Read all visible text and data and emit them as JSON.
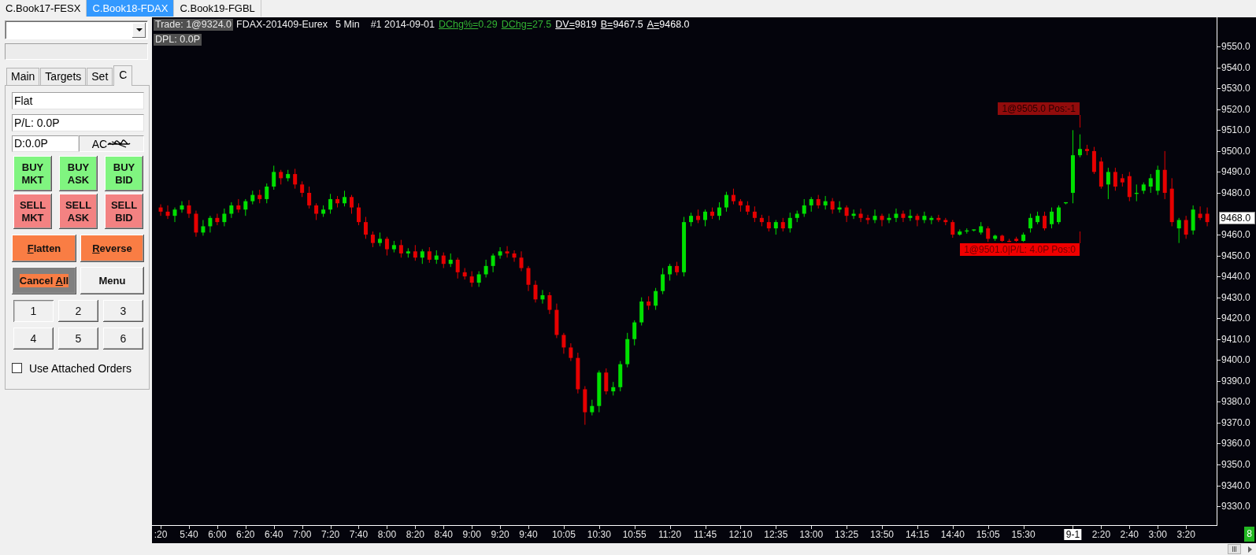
{
  "tabs": [
    {
      "label": "C.Book17-FESX",
      "selected": false
    },
    {
      "label": "C.Book18-FDAX",
      "selected": true
    },
    {
      "label": "C.Book19-FGBL",
      "selected": false
    }
  ],
  "panel": {
    "tabs": [
      {
        "label": "Main",
        "selected": false
      },
      {
        "label": "Targets",
        "selected": false
      },
      {
        "label": "Set",
        "selected": false
      },
      {
        "label": "C",
        "selected": true
      }
    ],
    "position": "Flat",
    "pl": "P/L: 0.0P",
    "daily": "D:0.0P",
    "account": "AC",
    "order_buttons": [
      {
        "kind": "buy",
        "lines": [
          "BUY",
          "MKT"
        ]
      },
      {
        "kind": "buy",
        "lines": [
          "BUY",
          "ASK"
        ]
      },
      {
        "kind": "buy",
        "lines": [
          "BUY",
          "BID"
        ]
      },
      {
        "kind": "sell",
        "lines": [
          "SELL",
          "MKT"
        ]
      },
      {
        "kind": "sell",
        "lines": [
          "SELL",
          "ASK"
        ]
      },
      {
        "kind": "sell",
        "lines": [
          "SELL",
          "BID"
        ]
      }
    ],
    "action_buttons": [
      {
        "kind": "accent",
        "mnemonic": "F",
        "label_end": "latten"
      },
      {
        "kind": "accent",
        "mnemonic": "R",
        "label_end": "everse"
      },
      {
        "kind": "shaded",
        "label_start": "Cancel ",
        "mnemonic": "A",
        "label_end": "ll"
      },
      {
        "kind": "plain",
        "label_start": "Menu"
      }
    ],
    "quantity_buttons": [
      {
        "label": "1",
        "selected": true
      },
      {
        "label": "2",
        "selected": false
      },
      {
        "label": "3",
        "selected": false
      },
      {
        "label": "4",
        "selected": false
      },
      {
        "label": "5",
        "selected": false
      },
      {
        "label": "6",
        "selected": false
      }
    ],
    "attached_orders": {
      "label": "Use Attached Orders",
      "checked": false
    }
  },
  "chart": {
    "header": {
      "trade": "Trade: 1@9324.0",
      "instrument": "FDAX-201409-Eurex",
      "interval": "5 Min",
      "bar_info": "#1 2014-09-01",
      "stats": [
        {
          "label": "DChg%=",
          "value": "0.29",
          "color": "#33b533"
        },
        {
          "label": "DChg=",
          "value": "27.5",
          "color": "#33b533"
        },
        {
          "label": "DV=",
          "value": "9819",
          "color": "#ffffff"
        },
        {
          "label": "B=",
          "value": "9467.5",
          "color": "#ffffff"
        },
        {
          "label": "A=",
          "value": "9468.0",
          "color": "#ffffff"
        }
      ],
      "dpl": "DPL: 0.0P"
    },
    "orders": [
      {
        "kind": "working",
        "text": "1@9505.0 Pos:-1"
      },
      {
        "kind": "filled",
        "text": "1@9501.0|P/L: 4.0P Pos:0"
      }
    ],
    "chart_data": {
      "type": "candlestick",
      "categories": [
        ":20",
        null,
        null,
        null,
        "5:40",
        null,
        null,
        null,
        "6:00",
        null,
        null,
        null,
        "6:20",
        null,
        null,
        null,
        "6:40",
        null,
        null,
        null,
        "7:00",
        null,
        null,
        null,
        "7:20",
        null,
        null,
        null,
        "7:40",
        null,
        null,
        null,
        "8:00",
        null,
        null,
        null,
        "8:20",
        null,
        null,
        null,
        "8:40",
        null,
        null,
        null,
        "9:00",
        null,
        null,
        null,
        "9:20",
        null,
        null,
        null,
        "9:40",
        null,
        null,
        null,
        null,
        "10:05",
        null,
        null,
        null,
        null,
        "10:30",
        null,
        null,
        null,
        null,
        "10:55",
        null,
        null,
        null,
        null,
        "11:20",
        null,
        null,
        null,
        null,
        "11:45",
        null,
        null,
        null,
        null,
        "12:10",
        null,
        null,
        null,
        null,
        "12:35",
        null,
        null,
        null,
        null,
        "13:00",
        null,
        null,
        null,
        null,
        "13:25",
        null,
        null,
        null,
        null,
        "13:50",
        null,
        null,
        null,
        null,
        "14:15",
        null,
        null,
        null,
        null,
        "14:40",
        null,
        null,
        null,
        null,
        "15:05",
        null,
        null,
        null,
        null,
        "15:30",
        null,
        null,
        null,
        null,
        null,
        null,
        null,
        null,
        null,
        null,
        "2:20",
        null,
        null,
        null,
        "2:40",
        null,
        null,
        null,
        "3:00",
        null,
        null,
        null,
        "3:20",
        null,
        null,
        null
      ],
      "ohlc": [
        [
          9473,
          9474.5,
          9469,
          9471
        ],
        [
          9471,
          9474,
          9467.5,
          9469
        ],
        [
          9469,
          9473,
          9466,
          9472
        ],
        [
          9472,
          9476,
          9470.5,
          9474
        ],
        [
          9474,
          9476.5,
          9468,
          9470
        ],
        [
          9470,
          9471.5,
          9459,
          9461
        ],
        [
          9461,
          9467,
          9459.5,
          9464
        ],
        [
          9464,
          9469,
          9461,
          9468
        ],
        [
          9468,
          9470,
          9464.5,
          9466
        ],
        [
          9466,
          9472.5,
          9464,
          9470
        ],
        [
          9470,
          9475.5,
          9468,
          9474
        ],
        [
          9474,
          9477,
          9470.5,
          9472
        ],
        [
          9472,
          9477,
          9469,
          9476
        ],
        [
          9476,
          9481,
          9474.5,
          9479
        ],
        [
          9479,
          9481.5,
          9475,
          9477
        ],
        [
          9477,
          9484.5,
          9475,
          9483
        ],
        [
          9483,
          9493,
          9481.5,
          9490
        ],
        [
          9490,
          9491,
          9484,
          9487
        ],
        [
          9487,
          9491,
          9485.5,
          9489
        ],
        [
          9489,
          9491.5,
          9482,
          9484
        ],
        [
          9484,
          9485.5,
          9478,
          9480
        ],
        [
          9480,
          9483,
          9472.5,
          9474
        ],
        [
          9474,
          9475,
          9467,
          9470
        ],
        [
          9470,
          9474,
          9468.5,
          9472
        ],
        [
          9472,
          9479.5,
          9470,
          9477
        ],
        [
          9477,
          9478.5,
          9473,
          9475
        ],
        [
          9475,
          9481,
          9473.5,
          9478
        ],
        [
          9478,
          9479,
          9470,
          9473
        ],
        [
          9473,
          9475,
          9464.5,
          9466
        ],
        [
          9466,
          9468.5,
          9458,
          9460
        ],
        [
          9460,
          9461.5,
          9454,
          9456
        ],
        [
          9456,
          9461,
          9454.5,
          9458
        ],
        [
          9458,
          9459,
          9450,
          9453
        ],
        [
          9453,
          9457,
          9451.5,
          9455
        ],
        [
          9455,
          9457.5,
          9449,
          9451
        ],
        [
          9451,
          9453.5,
          9449,
          9452
        ],
        [
          9452,
          9455,
          9447.5,
          9449
        ],
        [
          9449,
          9453,
          9446,
          9452
        ],
        [
          9452,
          9454,
          9446.5,
          9448
        ],
        [
          9448,
          9452.5,
          9446,
          9450
        ],
        [
          9450,
          9451.5,
          9444,
          9446
        ],
        [
          9446,
          9451,
          9444.5,
          9448
        ],
        [
          9448,
          9449,
          9439,
          9442
        ],
        [
          9442,
          9444,
          9438.5,
          9440
        ],
        [
          9440,
          9442.5,
          9435,
          9437
        ],
        [
          9437,
          9442.5,
          9435,
          9441
        ],
        [
          9441,
          9448,
          9439.5,
          9445
        ],
        [
          9445,
          9451,
          9442,
          9450
        ],
        [
          9450,
          9454,
          9448.5,
          9452
        ],
        [
          9452,
          9454.5,
          9449,
          9451
        ],
        [
          9451,
          9452.5,
          9447,
          9449
        ],
        [
          9449,
          9452,
          9442.5,
          9444
        ],
        [
          9444,
          9445,
          9433,
          9436
        ],
        [
          9436,
          9438,
          9427.5,
          9429
        ],
        [
          9429,
          9433.5,
          9427,
          9431
        ],
        [
          9431,
          9432.5,
          9422,
          9424
        ],
        [
          9424,
          9427,
          9410.5,
          9412
        ],
        [
          9412,
          9413,
          9403,
          9406
        ],
        [
          9406,
          9408,
          9399.5,
          9401
        ],
        [
          9401,
          9403.5,
          9384,
          9386
        ],
        [
          9386,
          9387.5,
          9369,
          9375
        ],
        [
          9375,
          9381,
          9373.5,
          9378
        ],
        [
          9378,
          9395,
          9375,
          9394
        ],
        [
          9394,
          9396,
          9383.5,
          9385
        ],
        [
          9385,
          9389.5,
          9383,
          9387
        ],
        [
          9387,
          9399.5,
          9385,
          9398
        ],
        [
          9398,
          9413,
          9396.5,
          9410
        ],
        [
          9410,
          9419,
          9407,
          9418
        ],
        [
          9418,
          9430,
          9416.5,
          9428
        ],
        [
          9428,
          9430.5,
          9424,
          9426
        ],
        [
          9426,
          9434.5,
          9424,
          9433
        ],
        [
          9433,
          9444,
          9431.5,
          9441
        ],
        [
          9441,
          9446,
          9438,
          9445
        ],
        [
          9445,
          9447,
          9440.5,
          9442
        ],
        [
          9442,
          9468.5,
          9440,
          9466
        ],
        [
          9466,
          9470.5,
          9464,
          9469
        ],
        [
          9469,
          9472,
          9465.5,
          9467
        ],
        [
          9467,
          9472,
          9464,
          9471
        ],
        [
          9471,
          9473,
          9467.5,
          9469
        ],
        [
          9469,
          9475.5,
          9467,
          9473
        ],
        [
          9473,
          9480.5,
          9471,
          9479
        ],
        [
          9479,
          9482,
          9474.5,
          9476
        ],
        [
          9476,
          9477,
          9471,
          9474
        ],
        [
          9474,
          9476,
          9469.5,
          9471
        ],
        [
          9471,
          9473.5,
          9466,
          9468
        ],
        [
          9468,
          9469.5,
          9464,
          9466
        ],
        [
          9466,
          9469,
          9461.5,
          9463
        ],
        [
          9463,
          9467,
          9460,
          9466
        ],
        [
          9466,
          9468,
          9461.5,
          9463
        ],
        [
          9463,
          9470.5,
          9461,
          9468
        ],
        [
          9468,
          9471.5,
          9466,
          9470
        ],
        [
          9470,
          9477,
          9468.5,
          9474
        ],
        [
          9474,
          9478,
          9471,
          9477
        ],
        [
          9477,
          9479,
          9472.5,
          9474
        ],
        [
          9474,
          9478.5,
          9472,
          9476
        ],
        [
          9476,
          9477.5,
          9470,
          9472
        ],
        [
          9472,
          9476,
          9470.5,
          9473
        ],
        [
          9473,
          9474,
          9466,
          9469
        ],
        [
          9469,
          9472,
          9467.5,
          9470
        ],
        [
          9470,
          9472.5,
          9466,
          9468
        ],
        [
          9468,
          9469.5,
          9465,
          9467
        ],
        [
          9467,
          9472,
          9465.5,
          9469
        ],
        [
          9469,
          9470,
          9464,
          9467
        ],
        [
          9467,
          9470,
          9465.5,
          9468
        ],
        [
          9468,
          9472.5,
          9466,
          9470
        ],
        [
          9470,
          9471.5,
          9466,
          9468
        ],
        [
          9468,
          9472,
          9466.5,
          9469
        ],
        [
          9469,
          9470,
          9464,
          9467
        ],
        [
          9467,
          9471,
          9465.5,
          9469
        ],
        [
          9467,
          9469,
          9465,
          9468
        ],
        [
          9468,
          9469.5,
          9466,
          9467
        ],
        [
          9467,
          9468,
          9464.5,
          9466
        ],
        [
          9466,
          9467,
          9458.5,
          9460
        ],
        [
          9460,
          9462.5,
          9459.5,
          9461.5
        ],
        [
          9461.5,
          9463,
          9460.5,
          9462
        ],
        [
          9462,
          9462.5,
          9461.5,
          9462.5
        ],
        [
          9461,
          9466,
          9460,
          9464
        ],
        [
          9463,
          9464,
          9456.5,
          9458
        ],
        [
          9458,
          9460,
          9457,
          9459.5
        ],
        [
          9459.5,
          9460,
          9456.5,
          9457
        ],
        [
          9457,
          9458,
          9456.5,
          9456.5
        ],
        [
          9458,
          9459,
          9456.5,
          9457
        ],
        [
          9457,
          9461,
          9456.5,
          9460
        ],
        [
          9463,
          9470,
          9461,
          9468
        ],
        [
          9466,
          9471,
          9465,
          9469
        ],
        [
          9469,
          9471,
          9462,
          9463
        ],
        [
          9465,
          9473,
          9463,
          9471
        ],
        [
          9466,
          9474,
          9465,
          9473
        ],
        [
          9475,
          9475.5,
          9474.5,
          9475.5
        ],
        [
          9480,
          9510,
          9475,
          9498
        ],
        [
          9498,
          9508,
          9497,
          9501
        ],
        [
          9501,
          9503,
          9498,
          9500
        ],
        [
          9500,
          9502,
          9489,
          9490
        ],
        [
          9495,
          9497,
          9482,
          9483
        ],
        [
          9484,
          9492,
          9477,
          9490
        ],
        [
          9490,
          9492,
          9481,
          9483
        ],
        [
          9487,
          9489,
          9483,
          9485
        ],
        [
          9488,
          9490,
          9476,
          9478
        ],
        [
          9479.5,
          9484,
          9476,
          9480
        ],
        [
          9481,
          9485,
          9479.5,
          9484
        ],
        [
          9483,
          9489,
          9480,
          9487
        ],
        [
          9481,
          9493,
          9479,
          9491
        ],
        [
          9491,
          9500,
          9477,
          9480
        ],
        [
          9482,
          9487,
          9464,
          9466
        ],
        [
          9463,
          9468,
          9456,
          9467
        ],
        [
          9467,
          9469,
          9458,
          9460
        ],
        [
          9462,
          9474,
          9460,
          9472
        ],
        [
          9470,
          9473.5,
          9467,
          9468
        ],
        [
          9470,
          9473,
          9464,
          9466
        ]
      ],
      "ylim": [
        9321,
        9564
      ],
      "yticks": [
        {
          "value": 9550,
          "label": "9550.0"
        },
        {
          "value": 9540,
          "label": "9540.0"
        },
        {
          "value": 9530,
          "label": "9530.0"
        },
        {
          "value": 9520,
          "label": "9520.0"
        },
        {
          "value": 9510,
          "label": "9510.0"
        },
        {
          "value": 9500,
          "label": "9500.0"
        },
        {
          "value": 9490,
          "label": "9490.0"
        },
        {
          "value": 9480,
          "label": "9480.0"
        },
        {
          "value": 9460,
          "label": "9460.0"
        },
        {
          "value": 9450,
          "label": "9450.0"
        },
        {
          "value": 9440,
          "label": "9440.0"
        },
        {
          "value": 9430,
          "label": "9430.0"
        },
        {
          "value": 9420,
          "label": "9420.0"
        },
        {
          "value": 9410,
          "label": "9410.0"
        },
        {
          "value": 9400,
          "label": "9400.0"
        },
        {
          "value": 9390,
          "label": "9390.0"
        },
        {
          "value": 9380,
          "label": "9380.0"
        },
        {
          "value": 9370,
          "label": "9370.0"
        },
        {
          "value": 9360,
          "label": "9360.0"
        },
        {
          "value": 9350,
          "label": "9350.0"
        },
        {
          "value": 9340,
          "label": "9340.0"
        },
        {
          "value": 9330,
          "label": "9330.0"
        }
      ],
      "annotations": [
        "9468.0",
        "9-1"
      ]
    },
    "corner_badge": "8"
  }
}
